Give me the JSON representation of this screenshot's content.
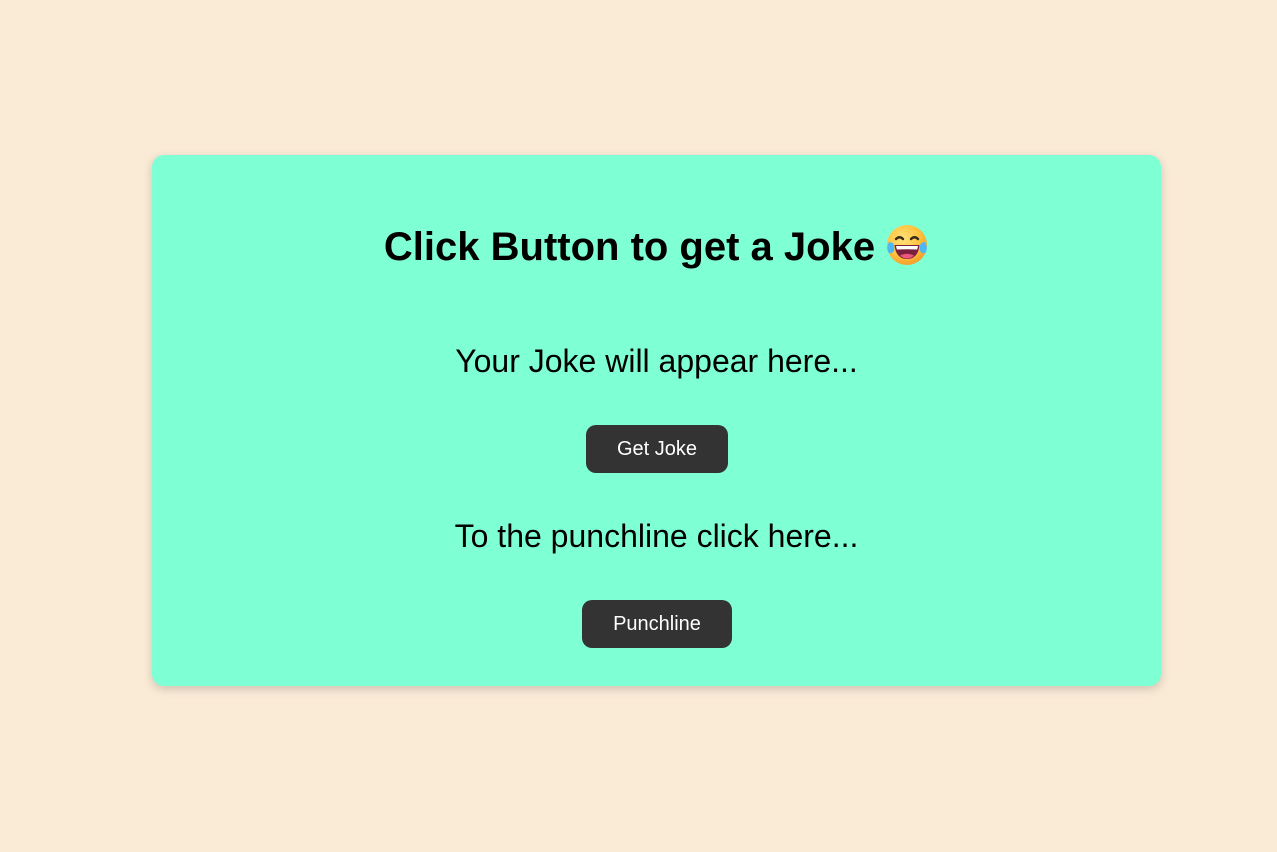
{
  "colors": {
    "page_background": "#faebd7",
    "card_background": "#7fffd4",
    "button_background": "#333333",
    "button_text": "#ffffff",
    "text": "#000000"
  },
  "card": {
    "title": "Click Button to get a Joke",
    "title_icon": "face-with-tears-of-joy-icon",
    "joke_text": "Your Joke will appear here...",
    "get_joke_label": "Get Joke",
    "punchline_prompt": "To the punchline click here...",
    "punchline_label": "Punchline"
  }
}
